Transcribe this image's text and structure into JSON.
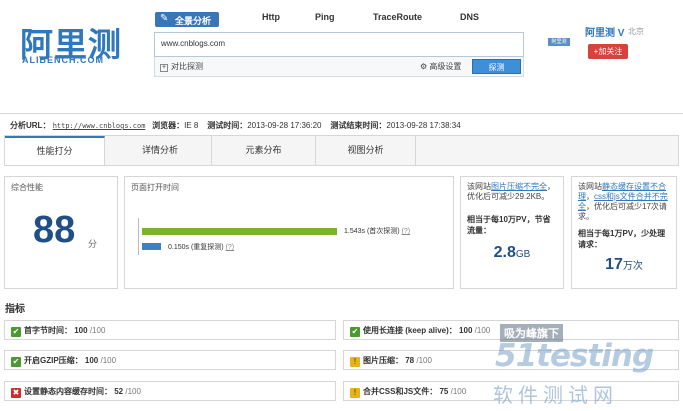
{
  "logo": {
    "cn": "阿里测",
    "en": "ALIBENCH.COM"
  },
  "top_tabs": [
    "全景分析",
    "Http",
    "Ping",
    "TraceRoute",
    "DNS"
  ],
  "search": {
    "value": "www.cnblogs.com",
    "compare_label": "对比探测",
    "advanced_label": "高级设置",
    "detect_button": "探测"
  },
  "user": {
    "name": "阿里测",
    "location": "北京",
    "follow_label": "+加关注",
    "image_label": "阿里测"
  },
  "info": {
    "url_label": "分析URL：",
    "url": "http://www.cnblogs.com",
    "browser_label": "浏览器：",
    "browser": "IE 8",
    "start_label": "测试时间：",
    "start": "2013-09-28 17:36:20",
    "end_label": "测试结束时间：",
    "end": "2013-09-28 17:38:34"
  },
  "analysis_tabs": [
    "性能打分",
    "详情分析",
    "元素分布",
    "视图分析"
  ],
  "score_panel": {
    "title": "综合性能",
    "value": "88",
    "unit": "分"
  },
  "load_panel": {
    "title": "页面打开时间",
    "first": {
      "label": "1.543s (首次探测)",
      "value": 1.543,
      "help": "(?)"
    },
    "repeat": {
      "label": "0.150s (重复探测)",
      "value": 0.15,
      "help": "(?)"
    }
  },
  "image_panel": {
    "pre": "该网站",
    "link": "图片压缩不完全",
    "post": "，优化后可减少29.2KB。",
    "bold": "相当于每10万PV，节省流量：",
    "value": "2.8",
    "unit": "GB"
  },
  "cache_panel": {
    "pre": "该网站",
    "link": "静态缓存设置不合理",
    "mid": "，",
    "link2": "css和js文件合并不完全",
    "post": "，优化后可减少17次请求。",
    "bold": "相当于每1万PV，少处理请求：",
    "value": "17",
    "unit": "万次"
  },
  "metrics_title": "指标",
  "metrics": [
    {
      "status": "ok",
      "label": "首字节时间：",
      "score": "100",
      "max": "/100"
    },
    {
      "status": "ok",
      "label": "使用长连接 (keep alive)：",
      "score": "100",
      "max": "/100"
    },
    {
      "status": "ok",
      "label": "开启GZIP压缩：",
      "score": "100",
      "max": "/100"
    },
    {
      "status": "warn",
      "label": "图片压缩：",
      "score": "78",
      "max": "/100"
    },
    {
      "status": "bad",
      "label": "设置静态内容缓存时间：",
      "score": "52",
      "max": "/100"
    },
    {
      "status": "warn",
      "label": "合并CSS和JS文件：",
      "score": "75",
      "max": "/100"
    }
  ],
  "watermark": {
    "line1": "吸为峰旗下",
    "line2": "51testing",
    "line3": "软件测试网"
  },
  "colors": {
    "brand": "#2f78bd",
    "ok": "#4a9a30",
    "warn": "#e6b416",
    "bad": "#c9302c",
    "bar_first": "#7bb32e",
    "bar_repeat": "#3e81c1"
  }
}
